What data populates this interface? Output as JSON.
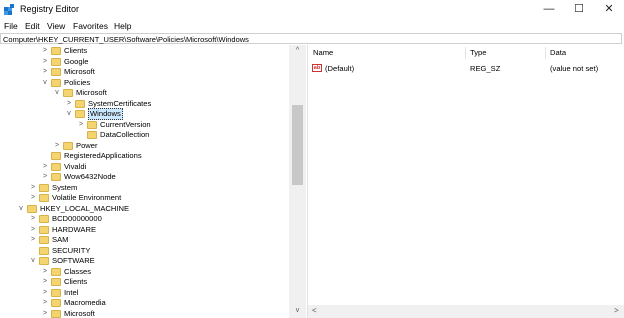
{
  "window": {
    "title": "Registry Editor",
    "minimize": "—",
    "maximize": "☐",
    "close": "✕"
  },
  "menu": [
    "File",
    "Edit",
    "View",
    "Favorites",
    "Help"
  ],
  "address": "Computer\\HKEY_CURRENT_USER\\Software\\Policies\\Microsoft\\Windows",
  "tree": [
    {
      "label": "Clients",
      "depth": 3,
      "exp": ">",
      "folder": true
    },
    {
      "label": "Google",
      "depth": 3,
      "exp": ">",
      "folder": true
    },
    {
      "label": "Microsoft",
      "depth": 3,
      "exp": ">",
      "folder": true
    },
    {
      "label": "Policies",
      "depth": 3,
      "exp": "v",
      "folder": true
    },
    {
      "label": "Microsoft",
      "depth": 4,
      "exp": "v",
      "folder": true
    },
    {
      "label": "SystemCertificates",
      "depth": 5,
      "exp": ">",
      "folder": true
    },
    {
      "label": "Windows",
      "depth": 5,
      "exp": "v",
      "folder": true,
      "selected": true
    },
    {
      "label": "CurrentVersion",
      "depth": 6,
      "exp": ">",
      "folder": true
    },
    {
      "label": "DataCollection",
      "depth": 6,
      "exp": "",
      "folder": true
    },
    {
      "label": "Power",
      "depth": 4,
      "exp": ">",
      "folder": true
    },
    {
      "label": "RegisteredApplications",
      "depth": 3,
      "exp": "",
      "folder": true
    },
    {
      "label": "Vivaldi",
      "depth": 3,
      "exp": ">",
      "folder": true
    },
    {
      "label": "Wow6432Node",
      "depth": 3,
      "exp": ">",
      "folder": true
    },
    {
      "label": "System",
      "depth": 2,
      "exp": ">",
      "folder": true
    },
    {
      "label": "Volatile Environment",
      "depth": 2,
      "exp": ">",
      "folder": true
    },
    {
      "label": "HKEY_LOCAL_MACHINE",
      "depth": 1,
      "exp": "v",
      "folder": true
    },
    {
      "label": "BCD00000000",
      "depth": 2,
      "exp": ">",
      "folder": true
    },
    {
      "label": "HARDWARE",
      "depth": 2,
      "exp": ">",
      "folder": true
    },
    {
      "label": "SAM",
      "depth": 2,
      "exp": ">",
      "folder": true
    },
    {
      "label": "SECURITY",
      "depth": 2,
      "exp": "",
      "folder": true
    },
    {
      "label": "SOFTWARE",
      "depth": 2,
      "exp": "v",
      "folder": true
    },
    {
      "label": "Classes",
      "depth": 3,
      "exp": ">",
      "folder": true
    },
    {
      "label": "Clients",
      "depth": 3,
      "exp": ">",
      "folder": true
    },
    {
      "label": "Intel",
      "depth": 3,
      "exp": ">",
      "folder": true
    },
    {
      "label": "Macromedia",
      "depth": 3,
      "exp": ">",
      "folder": true
    },
    {
      "label": "Microsoft",
      "depth": 3,
      "exp": ">",
      "folder": true
    }
  ],
  "columns": {
    "name": "Name",
    "type": "Type",
    "data": "Data"
  },
  "values": [
    {
      "icon": "ab",
      "name": "(Default)",
      "type": "REG_SZ",
      "data": "(value not set)"
    }
  ],
  "scroll": {
    "up": "^",
    "down": "v",
    "left": "<",
    "right": ">"
  },
  "colors": {
    "folder": "#f3d46e",
    "selection": "#cce8ff"
  }
}
